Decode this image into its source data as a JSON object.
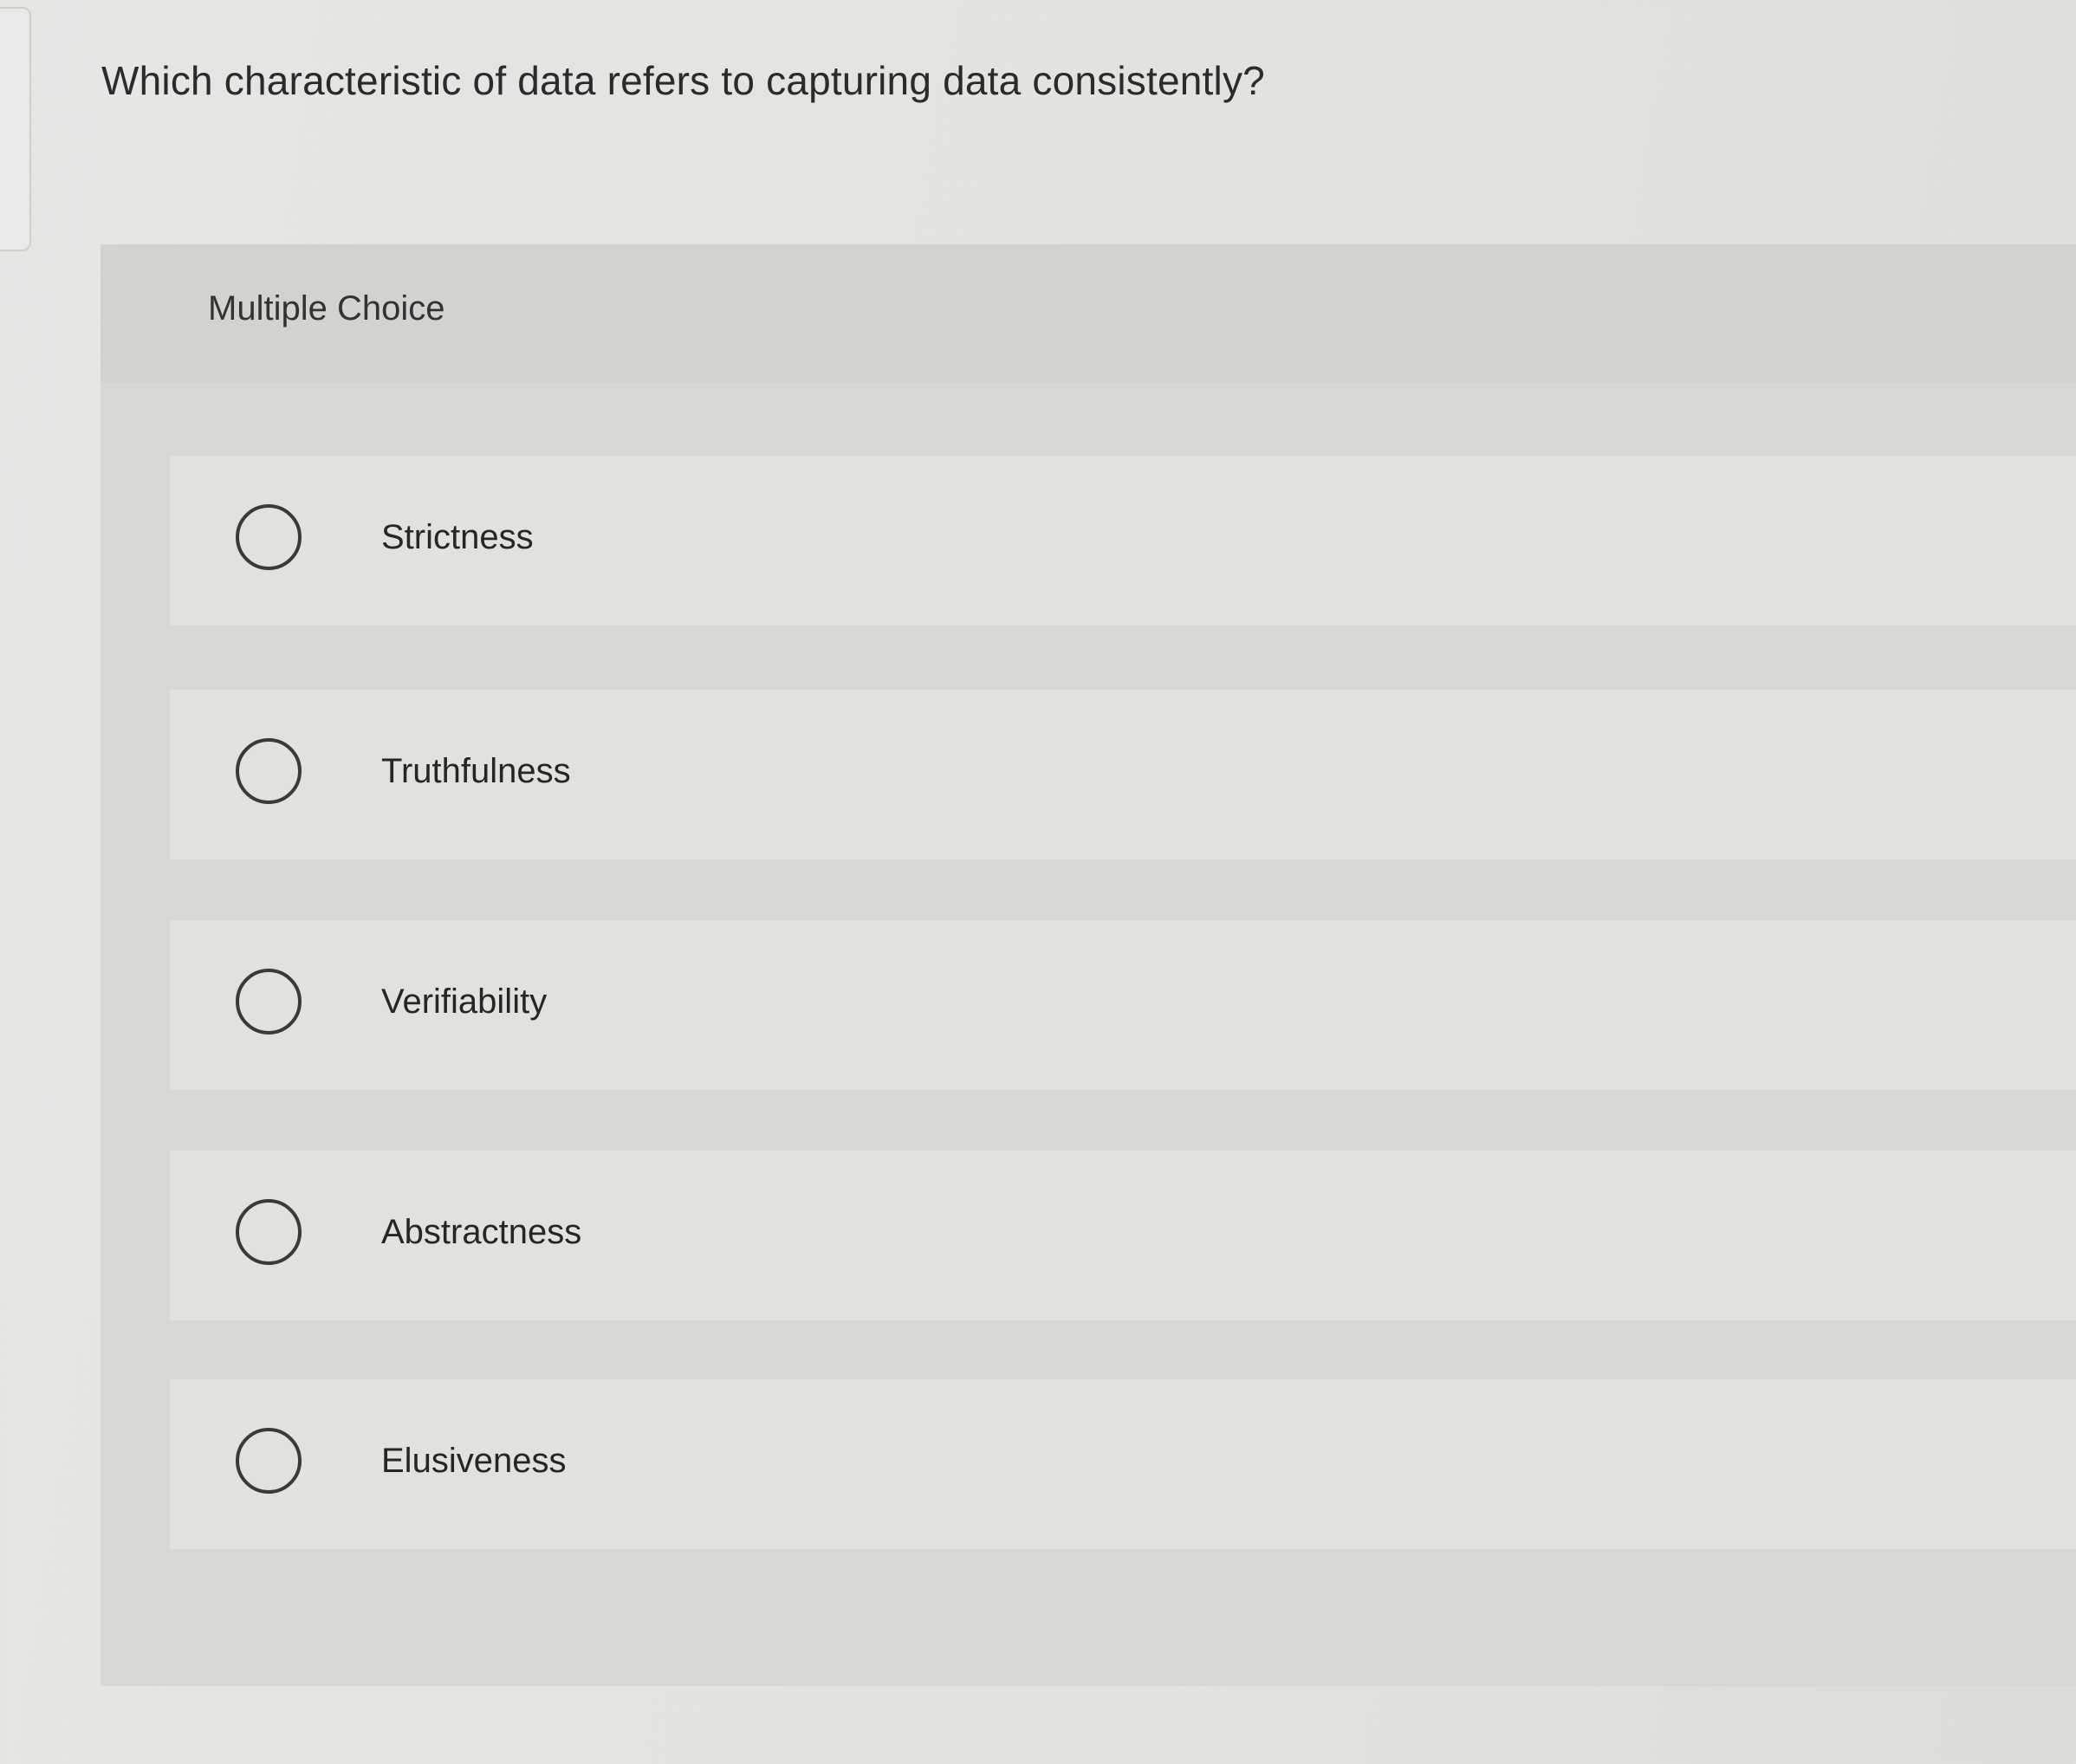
{
  "question": {
    "text": "Which characteristic of data refers to capturing data consistently?"
  },
  "panel": {
    "type_label": "Multiple Choice"
  },
  "choices": [
    {
      "label": "Strictness",
      "selected": false
    },
    {
      "label": "Truthfulness",
      "selected": false
    },
    {
      "label": "Verifiability",
      "selected": false
    },
    {
      "label": "Abstractness",
      "selected": false
    },
    {
      "label": "Elusiveness",
      "selected": false
    }
  ]
}
